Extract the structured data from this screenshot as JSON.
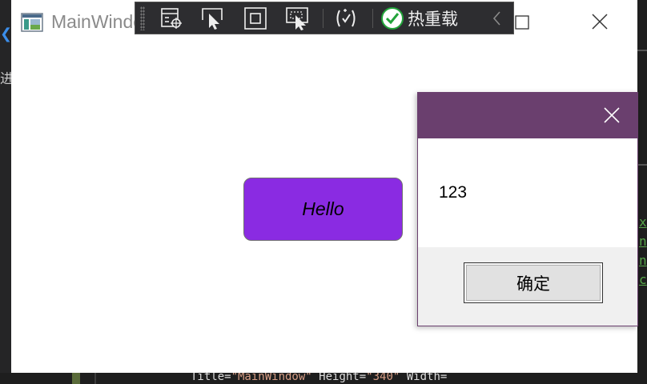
{
  "window": {
    "title": "MainWindow",
    "icon": "wpf-window-icon"
  },
  "debug_toolbar": {
    "buttons": [
      {
        "icon": "go-to-live-visual-tree-icon"
      },
      {
        "icon": "select-element-icon"
      },
      {
        "icon": "display-layout-adorners-icon"
      },
      {
        "icon": "track-focused-element-icon"
      },
      {
        "icon": "binding-failures-icon"
      }
    ],
    "hot_reload_label": "热重载",
    "hot_reload_status_color": "#22a33a"
  },
  "content": {
    "hello_button_label": "Hello",
    "hello_button_color": "#8a2be2"
  },
  "dialog": {
    "titlebar_color": "#6a3f6e",
    "message": "123",
    "ok_label": "确定"
  },
  "background_ide": {
    "side_char": "进",
    "code_line_prefix": "Title=",
    "code_line_str1": "\"MainWindow\"",
    "code_line_mid": " Height=",
    "code_line_str2": "\"340\"",
    "code_line_suffix": " Width="
  }
}
